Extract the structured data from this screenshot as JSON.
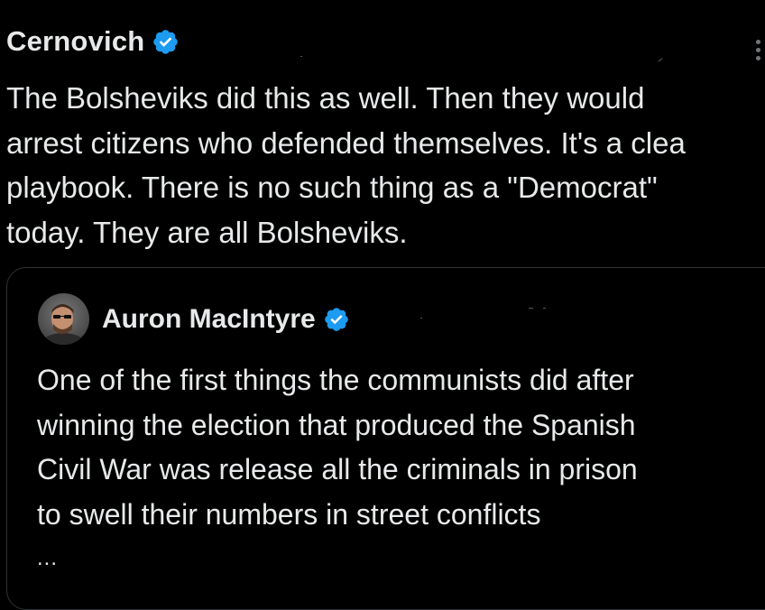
{
  "colors": {
    "background": "#000000",
    "text": "#e7e9ea",
    "verified": "#1d9bf0",
    "border": "#2f3336",
    "muted": "#71767b"
  },
  "tweet": {
    "author": "Cernovich",
    "verified_icon": "verified-badge-icon",
    "more_icon": "more-options-icon",
    "lines": [
      "The Bolsheviks did this as well. Then they would",
      "arrest citizens who defended themselves. It's a clea",
      "playbook. There is no such thing as a \"Democrat\"",
      "today. They are all Bolsheviks."
    ]
  },
  "quote": {
    "author": "Auron MacIntyre",
    "verified_icon": "verified-badge-icon",
    "avatar_icon": "avatar-photo",
    "lines": [
      "One of the first things the communists did after",
      "winning the election that produced the Spanish",
      "Civil War was release all the criminals in prison",
      "to swell their numbers in street conflicts"
    ],
    "ellipsis": "..."
  }
}
